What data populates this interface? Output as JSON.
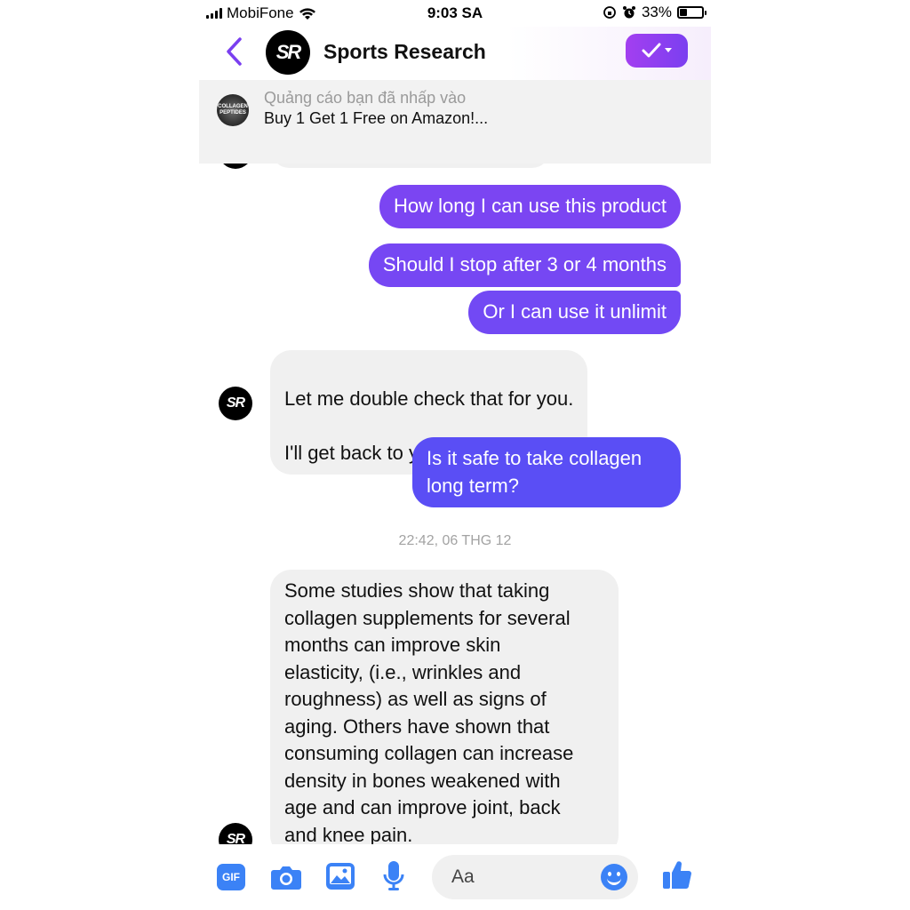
{
  "status_bar": {
    "carrier": "MobiFone",
    "time": "9:03 SA",
    "battery": "33%",
    "battery_level": 0.33
  },
  "header": {
    "avatar_text": "SR",
    "title": "Sports Research",
    "verify_icon": "checkmark-icon"
  },
  "ad": {
    "thumb_lines": [
      "COLLAGEN",
      "PEPTIDES"
    ],
    "subtitle": "Quảng cáo bạn đã nhấp vào",
    "title": "Buy 1 Get 1 Free on Amazon!..."
  },
  "messages": {
    "m1": "How long I can use this product",
    "m2": "Should I stop after 3 or 4 months",
    "m3": "Or I can use it unlimit",
    "m4_line1": "Let me double check that for you.",
    "m4_line2": "I'll  get back to you asap",
    "m5": "Is it safe to take collagen\nlong term?",
    "timestamp": "22:42, 06 THG 12",
    "m6": "Some studies show that taking\ncollagen supplements for several\nmonths can improve skin\nelasticity, (i.e., wrinkles and\nroughness) as well as signs of\naging. Others have shown that\nconsuming collagen can increase\ndensity in bones weakened with\nage and can improve joint, back\nand knee pain."
  },
  "composer": {
    "gif_label": "GIF",
    "placeholder": "Aa"
  },
  "colors": {
    "accent": "#7a3ff0",
    "outgoing_top": "#7b45f2",
    "outgoing_bottom": "#5a4ef5",
    "incoming_bg": "#f0f0f0",
    "icon_blue": "#3b82f6"
  }
}
